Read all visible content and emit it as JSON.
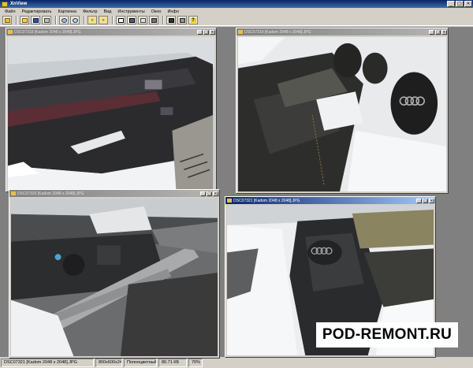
{
  "app": {
    "title": "XnView"
  },
  "menu": [
    "Файл",
    "Редактировать",
    "Картинка",
    "Фильтр",
    "Вид",
    "Инструменты",
    "Окно",
    "Инфо"
  ],
  "toolbar": {
    "buttons": [
      "open-icon",
      "browse-icon",
      "save-icon",
      "print-icon",
      "zoom-in-icon",
      "zoom-out-icon",
      "previous-icon",
      "next-icon",
      "fit-icon",
      "full-screen-icon",
      "slideshow-icon",
      "scan-icon",
      "capture-icon",
      "options-icon",
      "help-icon"
    ]
  },
  "windows": [
    {
      "title": "DSC07318 [Kadom 2048 x 2048].JPG",
      "active": false
    },
    {
      "title": "DSC07319 [Kadom 2048 x 2048].JPG",
      "active": false
    },
    {
      "title": "DSC07320 [Kadom 2048 x 2048].JPG",
      "active": false
    },
    {
      "title": "DSC07321 [Kadom 2048 x 2048].JPG",
      "active": true
    }
  ],
  "status": {
    "file": "DSC07321 [Kadom 2048 x 2048].JPG",
    "dims": "800x600x24",
    "mode": "Полноцветный",
    "size": "80.71 КБ",
    "zoom": "70%"
  },
  "watermark": "POD-REMONT.RU",
  "colors": {
    "title_active": "#0a246a",
    "title_inactive": "#808080",
    "workspace": "#808080",
    "chrome": "#d4d0c8"
  }
}
